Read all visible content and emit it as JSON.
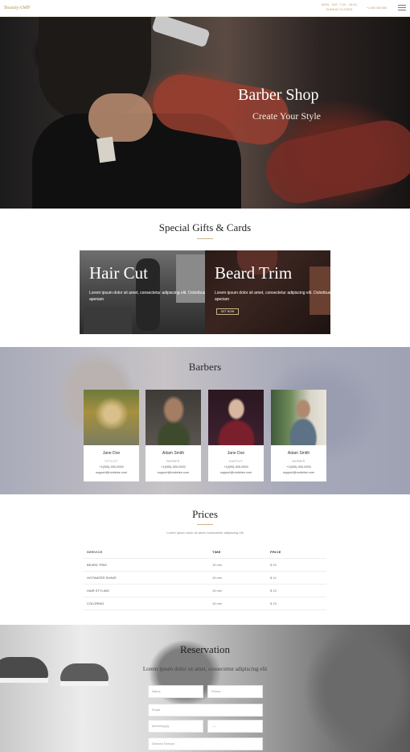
{
  "header": {
    "brand": "BeautyAMP",
    "hours_line1": "MON - SAT: 7:00 - 18:00",
    "hours_line2": "SUNDAY CLOSED",
    "phone": "+1 000 000 000"
  },
  "hero": {
    "title": "Barber Shop",
    "subtitle": "Create Your Style"
  },
  "gifts": {
    "title": "Special Gifts & Cards",
    "cards": [
      {
        "title": "Hair Cut",
        "text": "Lorem ipsum dolor sit amet, consectetur adipiscing elit. Doloribus aperiam",
        "button": ""
      },
      {
        "title": "Beard Trim",
        "text": "Lorem ipsum dolor sit amet, consectetur adipiscing elit. Doloribus aperiam",
        "button": "GET NOW"
      }
    ]
  },
  "barbers": {
    "title": "Barbers",
    "people": [
      {
        "name": "Jane Doe",
        "role": "STYLIST",
        "phone": "+1(000)-000-0000",
        "email": "support@mobirise.com"
      },
      {
        "name": "Adam Smith",
        "role": "BARBER",
        "phone": "+1(000)-000-0000",
        "email": "support@mobirise.com"
      },
      {
        "name": "Jane Doe",
        "role": "HAIRCUT",
        "phone": "+1(000)-000-0000",
        "email": "support@mobirise.com"
      },
      {
        "name": "Adam Smith",
        "role": "BARBER",
        "phone": "+1(000)-000-0000",
        "email": "support@mobirise.com"
      }
    ]
  },
  "prices": {
    "title": "Prices",
    "subtitle": "Lorem ipsum dolor sit amet consectetur adipiscing elit",
    "headers": [
      "SERVICE",
      "TIME",
      "PRICE"
    ],
    "rows": [
      [
        "BEARD TRIM",
        "15 min",
        "$ 15"
      ],
      [
        "HOTWATER SHAVE",
        "15 min",
        "$ 10"
      ],
      [
        "HAIR STYLING",
        "15 min",
        "$ 15"
      ],
      [
        "COLORING",
        "15 min",
        "$ 15"
      ]
    ]
  },
  "reservation": {
    "title": "Reservation",
    "subtitle": "Lorem ipsum dolor sit amet, consectetur adipiscing elit",
    "placeholders": {
      "name": "Name",
      "phone": "Phone",
      "email": "Email",
      "date": "dd/mm/yyyy",
      "time": "--:--",
      "service": "Desired Service"
    }
  },
  "colors": {
    "accent": "#b49a64",
    "rule": "#c9b58a"
  }
}
